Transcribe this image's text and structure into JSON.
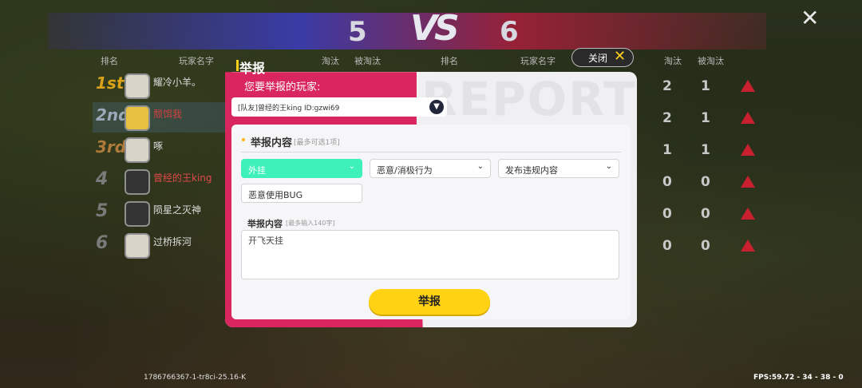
{
  "scoreboard": {
    "left_score": "5",
    "right_score": "6",
    "vs_label": "VS",
    "headers_left": [
      "排名",
      "玩家名字",
      "淘汰",
      "被淘汰"
    ],
    "headers_right": [
      "排名",
      "玩家名字",
      "淘汰",
      "被淘汰"
    ],
    "left_players": [
      {
        "rank": "1st",
        "name": "耀冷小羊。"
      },
      {
        "rank": "2nd",
        "name": "颓饵我"
      },
      {
        "rank": "3rd",
        "name": "啄"
      },
      {
        "rank": "4",
        "name": "曾经的王king"
      },
      {
        "rank": "5",
        "name": "陨星之灭神"
      },
      {
        "rank": "6",
        "name": "过桥拆河"
      }
    ],
    "right_stats": [
      {
        "kills": "2",
        "deaths": "1"
      },
      {
        "kills": "2",
        "deaths": "1"
      },
      {
        "kills": "1",
        "deaths": "1"
      },
      {
        "kills": "0",
        "deaths": "0"
      },
      {
        "kills": "0",
        "deaths": "0"
      },
      {
        "kills": "0",
        "deaths": "0"
      }
    ],
    "close_icon": "close-icon"
  },
  "footer": {
    "id_text": "1786766367-1-tr8ci-25.16-K",
    "fps_text": "FPS:59.72 - 34 - 38 - 0"
  },
  "modal": {
    "title": "举报",
    "watermark": "REPORT",
    "close_label": "关闭",
    "player_prompt": "您要举报的玩家:",
    "selected_player": "[队友]曾经的王king ID:gzwi69",
    "section_title": "举报内容",
    "section_hint": "[最多可选1项]",
    "options": [
      {
        "label": "外挂",
        "selected": true
      },
      {
        "label": "恶意/消极行为",
        "selected": false
      },
      {
        "label": "发布违规内容",
        "selected": false
      }
    ],
    "sub_option": "恶意使用BUG",
    "content_label": "举报内容",
    "content_hint": "[最多输入140字]",
    "content_value": "开飞天挂",
    "submit_label": "举报"
  },
  "colors": {
    "accent_pink": "#d9265f",
    "accent_yellow": "#ffd214",
    "selected_green": "#3ef0ba"
  }
}
